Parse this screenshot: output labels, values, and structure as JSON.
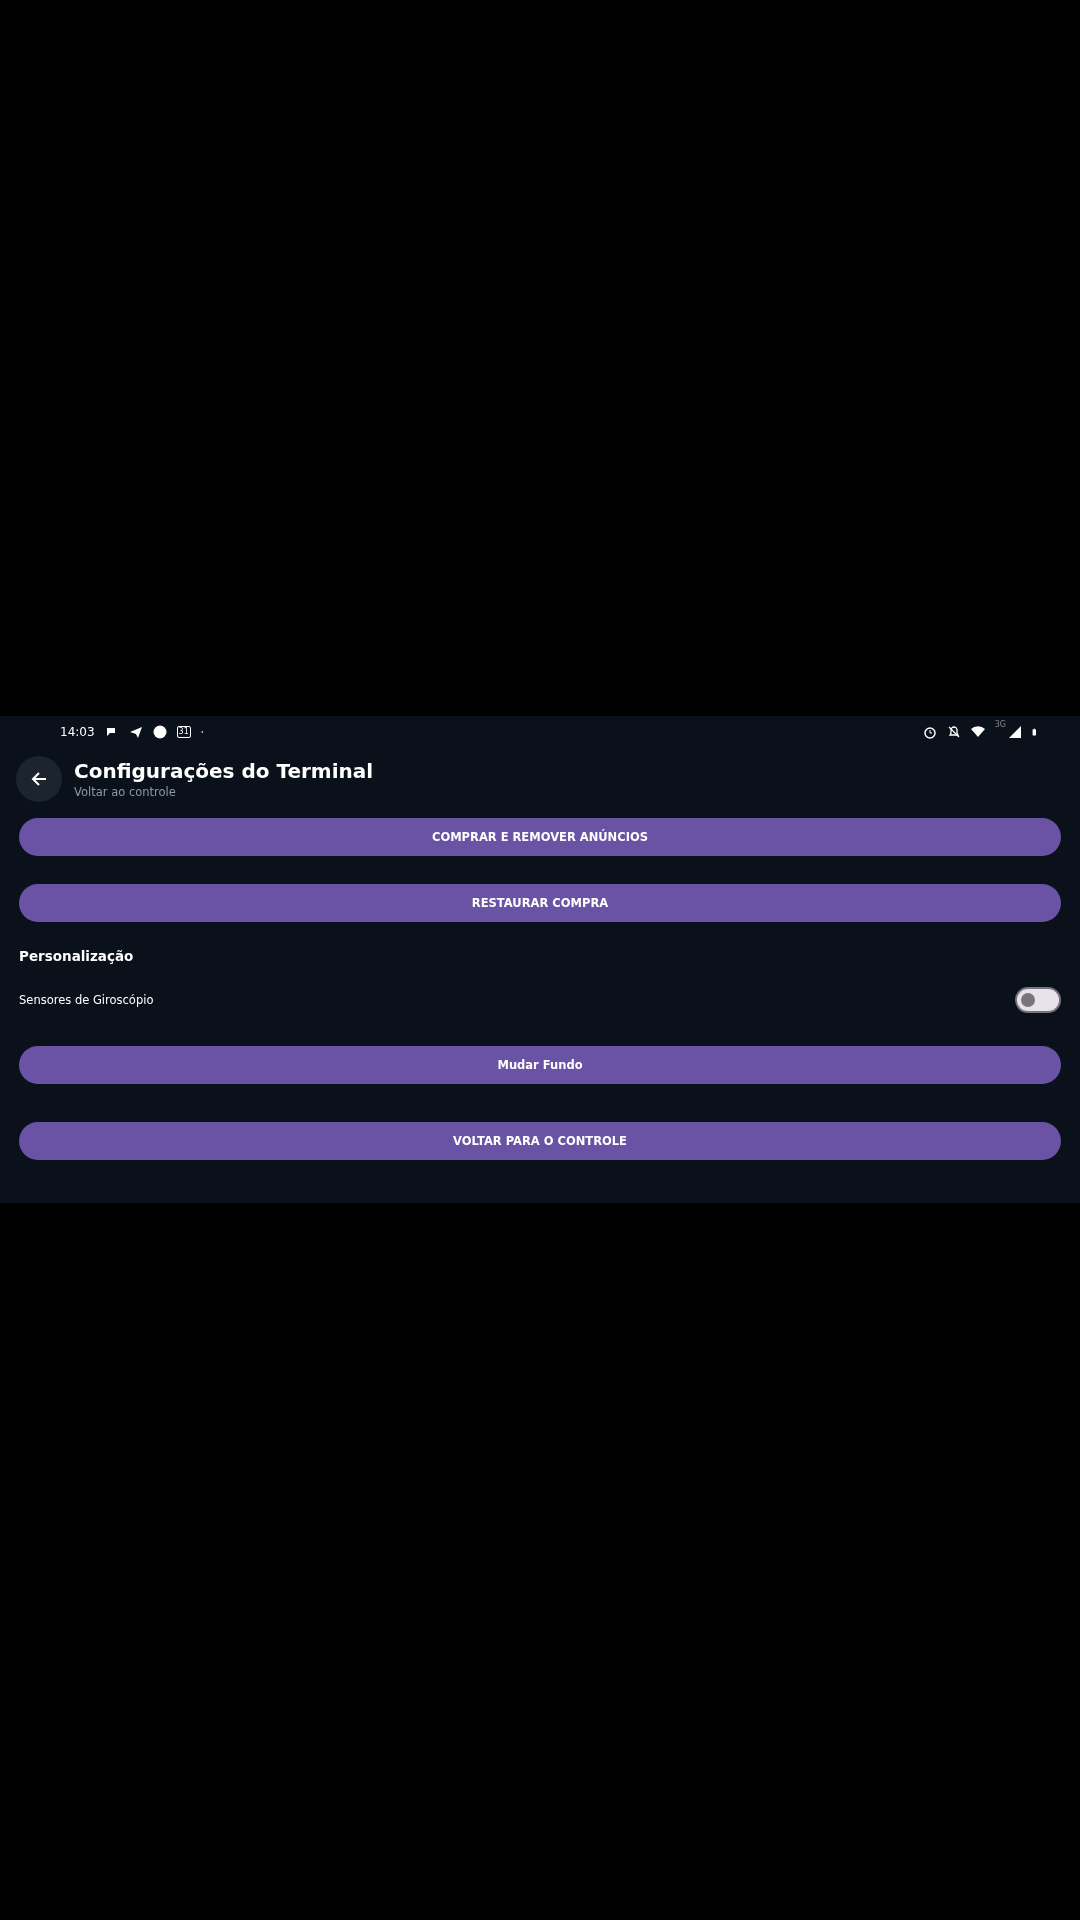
{
  "status_bar": {
    "time": "14:03",
    "calendar_day": "31",
    "network": "3G"
  },
  "header": {
    "title": "Configurações do Terminal",
    "subtitle": "Voltar ao controle"
  },
  "items": [
    {
      "kind": "button",
      "label": "COMPRAR E REMOVER ANÚNCIOS"
    },
    {
      "kind": "button",
      "label": "RESTAURAR COMPRA"
    },
    {
      "kind": "section",
      "label": "Personalização"
    },
    {
      "kind": "switch",
      "label": "Sensores de Giroscópio",
      "on": false
    },
    {
      "kind": "button",
      "label": "Mudar Fundo"
    },
    {
      "kind": "spacer"
    },
    {
      "kind": "button",
      "label": "VOLTAR PARA O CONTROLE"
    }
  ]
}
